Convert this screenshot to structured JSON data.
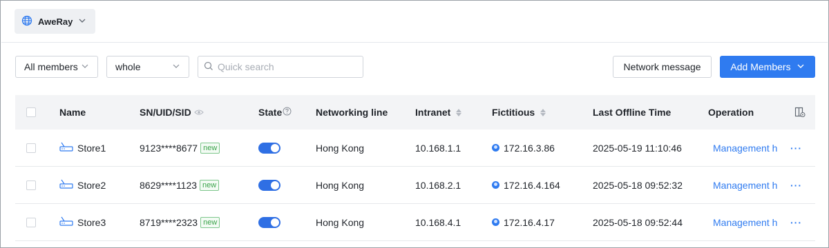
{
  "network": {
    "name": "AweRay"
  },
  "filters": {
    "members_select": "All members",
    "scope_select": "whole",
    "search_placeholder": "Quick search"
  },
  "actions": {
    "network_message": "Network message",
    "add_members": "Add Members"
  },
  "table": {
    "headers": {
      "name": "Name",
      "sn": "SN/UID/SID",
      "state": "State",
      "line": "Networking line",
      "intranet": "Intranet",
      "fictitious": "Fictitious",
      "last_offline": "Last Offline Time",
      "operation": "Operation"
    },
    "rows": [
      {
        "name": "Store1",
        "sn": "9123****8677",
        "badge": "new",
        "state_on": true,
        "line": "Hong Kong",
        "intranet": "10.168.1.1",
        "fictitious": "172.16.3.86",
        "last_offline": "2025-05-19 11:10:46",
        "op": "Management h",
        "more": "···"
      },
      {
        "name": "Store2",
        "sn": "8629****1123",
        "badge": "new",
        "state_on": true,
        "line": "Hong Kong",
        "intranet": "10.168.2.1",
        "fictitious": "172.16.4.164",
        "last_offline": "2025-05-18 09:52:32",
        "op": "Management h",
        "more": "···"
      },
      {
        "name": "Store3",
        "sn": "8719****2323",
        "badge": "new",
        "state_on": true,
        "line": "Hong Kong",
        "intranet": "10.168.4.1",
        "fictitious": "172.16.4.17",
        "last_offline": "2025-05-18 09:52:44",
        "op": "Management h",
        "more": "···"
      }
    ]
  },
  "icons": {
    "globe": "globe-icon",
    "chevron": "chevron-down-icon",
    "search": "search-icon",
    "eye": "eye-icon",
    "help": "help-circle-icon",
    "columns": "column-settings-icon",
    "router": "router-icon",
    "ip": "ip-status-icon"
  },
  "colors": {
    "primary": "#2f7bf0",
    "tag_green": "#3aa34a",
    "header_bg": "#f3f4f6"
  }
}
